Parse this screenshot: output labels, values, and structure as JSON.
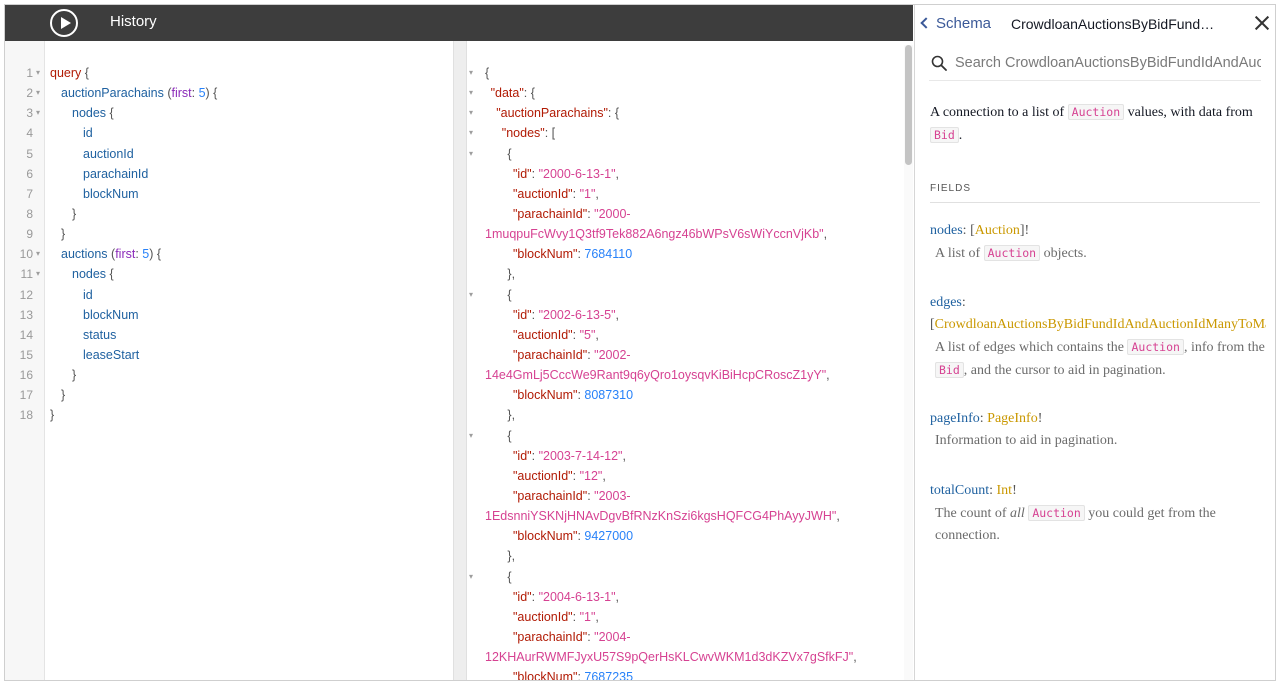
{
  "toolbar": {
    "history_label": "History"
  },
  "query": {
    "lines": [
      {
        "n": "1",
        "fold": true,
        "tokens": [
          {
            "t": "query",
            "c": "k-kw"
          },
          {
            "t": " {",
            "c": "k-punc"
          }
        ],
        "indent": 0
      },
      {
        "n": "2",
        "fold": true,
        "tokens": [
          {
            "t": "auctionParachains",
            "c": "k-def"
          },
          {
            "t": " (",
            "c": "k-punc"
          },
          {
            "t": "first",
            "c": "k-arg"
          },
          {
            "t": ": ",
            "c": "k-punc"
          },
          {
            "t": "5",
            "c": "k-num"
          },
          {
            "t": ") {",
            "c": "k-punc"
          }
        ],
        "indent": 1
      },
      {
        "n": "3",
        "fold": true,
        "tokens": [
          {
            "t": "nodes",
            "c": "k-def"
          },
          {
            "t": " {",
            "c": "k-punc"
          }
        ],
        "indent": 2
      },
      {
        "n": "4",
        "fold": false,
        "tokens": [
          {
            "t": "id",
            "c": "k-def"
          }
        ],
        "indent": 3
      },
      {
        "n": "5",
        "fold": false,
        "tokens": [
          {
            "t": "auctionId",
            "c": "k-def"
          }
        ],
        "indent": 3
      },
      {
        "n": "6",
        "fold": false,
        "tokens": [
          {
            "t": "parachainId",
            "c": "k-def"
          }
        ],
        "indent": 3
      },
      {
        "n": "7",
        "fold": false,
        "tokens": [
          {
            "t": "blockNum",
            "c": "k-def"
          }
        ],
        "indent": 3
      },
      {
        "n": "8",
        "fold": false,
        "tokens": [
          {
            "t": "}",
            "c": "k-punc"
          }
        ],
        "indent": 2
      },
      {
        "n": "9",
        "fold": false,
        "tokens": [
          {
            "t": "}",
            "c": "k-punc"
          }
        ],
        "indent": 1
      },
      {
        "n": "10",
        "fold": true,
        "tokens": [
          {
            "t": "auctions",
            "c": "k-def"
          },
          {
            "t": " (",
            "c": "k-punc"
          },
          {
            "t": "first",
            "c": "k-arg"
          },
          {
            "t": ": ",
            "c": "k-punc"
          },
          {
            "t": "5",
            "c": "k-num"
          },
          {
            "t": ") {",
            "c": "k-punc"
          }
        ],
        "indent": 1
      },
      {
        "n": "11",
        "fold": true,
        "tokens": [
          {
            "t": "nodes",
            "c": "k-def"
          },
          {
            "t": " {",
            "c": "k-punc"
          }
        ],
        "indent": 2
      },
      {
        "n": "12",
        "fold": false,
        "tokens": [
          {
            "t": "id",
            "c": "k-def"
          }
        ],
        "indent": 3
      },
      {
        "n": "13",
        "fold": false,
        "tokens": [
          {
            "t": "blockNum",
            "c": "k-def"
          }
        ],
        "indent": 3
      },
      {
        "n": "14",
        "fold": false,
        "tokens": [
          {
            "t": "status",
            "c": "k-def"
          }
        ],
        "indent": 3
      },
      {
        "n": "15",
        "fold": false,
        "tokens": [
          {
            "t": "leaseStart",
            "c": "k-def"
          }
        ],
        "indent": 3
      },
      {
        "n": "16",
        "fold": false,
        "tokens": [
          {
            "t": "}",
            "c": "k-punc"
          }
        ],
        "indent": 2
      },
      {
        "n": "17",
        "fold": false,
        "tokens": [
          {
            "t": "}",
            "c": "k-punc"
          }
        ],
        "indent": 1
      },
      {
        "n": "18",
        "fold": false,
        "tokens": [
          {
            "t": "}",
            "c": "k-punc"
          }
        ],
        "indent": 0
      }
    ]
  },
  "result": {
    "lines": [
      {
        "fold": true,
        "indent": 0,
        "tokens": [
          {
            "t": "{",
            "c": ""
          }
        ]
      },
      {
        "fold": true,
        "indent": 1,
        "tokens": [
          {
            "t": "\"data\"",
            "c": "r-key"
          },
          {
            "t": ": {",
            "c": ""
          }
        ]
      },
      {
        "fold": true,
        "indent": 2,
        "tokens": [
          {
            "t": "\"auctionParachains\"",
            "c": "r-key"
          },
          {
            "t": ": {",
            "c": ""
          }
        ]
      },
      {
        "fold": true,
        "indent": 3,
        "tokens": [
          {
            "t": "\"nodes\"",
            "c": "r-key"
          },
          {
            "t": ": [",
            "c": ""
          }
        ]
      },
      {
        "fold": true,
        "indent": 4,
        "tokens": [
          {
            "t": "{",
            "c": ""
          }
        ]
      },
      {
        "fold": false,
        "indent": 5,
        "tokens": [
          {
            "t": "\"id\"",
            "c": "r-key"
          },
          {
            "t": ": ",
            "c": ""
          },
          {
            "t": "\"2000-6-13-1\"",
            "c": "r-str"
          },
          {
            "t": ",",
            "c": ""
          }
        ]
      },
      {
        "fold": false,
        "indent": 5,
        "tokens": [
          {
            "t": "\"auctionId\"",
            "c": "r-key"
          },
          {
            "t": ": ",
            "c": ""
          },
          {
            "t": "\"1\"",
            "c": "r-str"
          },
          {
            "t": ",",
            "c": ""
          }
        ]
      },
      {
        "fold": false,
        "indent": 5,
        "tokens": [
          {
            "t": "\"parachainId\"",
            "c": "r-key"
          },
          {
            "t": ": ",
            "c": ""
          },
          {
            "t": "\"2000-",
            "c": "r-str"
          }
        ]
      },
      {
        "fold": false,
        "indent": 0,
        "tokens": [
          {
            "t": "1muqpuFcWvy1Q3tf9Tek882A6ngz46bWPsV6sWiYccnVjKb\"",
            "c": "r-str"
          },
          {
            "t": ",",
            "c": ""
          }
        ]
      },
      {
        "fold": false,
        "indent": 5,
        "tokens": [
          {
            "t": "\"blockNum\"",
            "c": "r-key"
          },
          {
            "t": ": ",
            "c": ""
          },
          {
            "t": "7684110",
            "c": "r-num"
          }
        ]
      },
      {
        "fold": false,
        "indent": 4,
        "tokens": [
          {
            "t": "},",
            "c": ""
          }
        ]
      },
      {
        "fold": true,
        "indent": 4,
        "tokens": [
          {
            "t": "{",
            "c": ""
          }
        ]
      },
      {
        "fold": false,
        "indent": 5,
        "tokens": [
          {
            "t": "\"id\"",
            "c": "r-key"
          },
          {
            "t": ": ",
            "c": ""
          },
          {
            "t": "\"2002-6-13-5\"",
            "c": "r-str"
          },
          {
            "t": ",",
            "c": ""
          }
        ]
      },
      {
        "fold": false,
        "indent": 5,
        "tokens": [
          {
            "t": "\"auctionId\"",
            "c": "r-key"
          },
          {
            "t": ": ",
            "c": ""
          },
          {
            "t": "\"5\"",
            "c": "r-str"
          },
          {
            "t": ",",
            "c": ""
          }
        ]
      },
      {
        "fold": false,
        "indent": 5,
        "tokens": [
          {
            "t": "\"parachainId\"",
            "c": "r-key"
          },
          {
            "t": ": ",
            "c": ""
          },
          {
            "t": "\"2002-",
            "c": "r-str"
          }
        ]
      },
      {
        "fold": false,
        "indent": 0,
        "tokens": [
          {
            "t": "14e4GmLj5CccWe9Rant9q6yQro1oysqvKiBiHcpCRoscZ1yY\"",
            "c": "r-str"
          },
          {
            "t": ",",
            "c": ""
          }
        ]
      },
      {
        "fold": false,
        "indent": 5,
        "tokens": [
          {
            "t": "\"blockNum\"",
            "c": "r-key"
          },
          {
            "t": ": ",
            "c": ""
          },
          {
            "t": "8087310",
            "c": "r-num"
          }
        ]
      },
      {
        "fold": false,
        "indent": 4,
        "tokens": [
          {
            "t": "},",
            "c": ""
          }
        ]
      },
      {
        "fold": true,
        "indent": 4,
        "tokens": [
          {
            "t": "{",
            "c": ""
          }
        ]
      },
      {
        "fold": false,
        "indent": 5,
        "tokens": [
          {
            "t": "\"id\"",
            "c": "r-key"
          },
          {
            "t": ": ",
            "c": ""
          },
          {
            "t": "\"2003-7-14-12\"",
            "c": "r-str"
          },
          {
            "t": ",",
            "c": ""
          }
        ]
      },
      {
        "fold": false,
        "indent": 5,
        "tokens": [
          {
            "t": "\"auctionId\"",
            "c": "r-key"
          },
          {
            "t": ": ",
            "c": ""
          },
          {
            "t": "\"12\"",
            "c": "r-str"
          },
          {
            "t": ",",
            "c": ""
          }
        ]
      },
      {
        "fold": false,
        "indent": 5,
        "tokens": [
          {
            "t": "\"parachainId\"",
            "c": "r-key"
          },
          {
            "t": ": ",
            "c": ""
          },
          {
            "t": "\"2003-",
            "c": "r-str"
          }
        ]
      },
      {
        "fold": false,
        "indent": 0,
        "tokens": [
          {
            "t": "1EdsnniYSKNjHNAvDgvBfRNzKnSzi6kgsHQFCG4PhAyyJWH\"",
            "c": "r-str"
          },
          {
            "t": ",",
            "c": ""
          }
        ]
      },
      {
        "fold": false,
        "indent": 5,
        "tokens": [
          {
            "t": "\"blockNum\"",
            "c": "r-key"
          },
          {
            "t": ": ",
            "c": ""
          },
          {
            "t": "9427000",
            "c": "r-num"
          }
        ]
      },
      {
        "fold": false,
        "indent": 4,
        "tokens": [
          {
            "t": "},",
            "c": ""
          }
        ]
      },
      {
        "fold": true,
        "indent": 4,
        "tokens": [
          {
            "t": "{",
            "c": ""
          }
        ]
      },
      {
        "fold": false,
        "indent": 5,
        "tokens": [
          {
            "t": "\"id\"",
            "c": "r-key"
          },
          {
            "t": ": ",
            "c": ""
          },
          {
            "t": "\"2004-6-13-1\"",
            "c": "r-str"
          },
          {
            "t": ",",
            "c": ""
          }
        ]
      },
      {
        "fold": false,
        "indent": 5,
        "tokens": [
          {
            "t": "\"auctionId\"",
            "c": "r-key"
          },
          {
            "t": ": ",
            "c": ""
          },
          {
            "t": "\"1\"",
            "c": "r-str"
          },
          {
            "t": ",",
            "c": ""
          }
        ]
      },
      {
        "fold": false,
        "indent": 5,
        "tokens": [
          {
            "t": "\"parachainId\"",
            "c": "r-key"
          },
          {
            "t": ": ",
            "c": ""
          },
          {
            "t": "\"2004-",
            "c": "r-str"
          }
        ]
      },
      {
        "fold": false,
        "indent": 0,
        "tokens": [
          {
            "t": "12KHAurRWMFJyxU57S9pQerHsKLCwvWKM1d3dKZVx7gSfkFJ\"",
            "c": "r-str"
          },
          {
            "t": ",",
            "c": ""
          }
        ]
      },
      {
        "fold": false,
        "indent": 5,
        "tokens": [
          {
            "t": "\"blockNum\"",
            "c": "r-key"
          },
          {
            "t": ": ",
            "c": ""
          },
          {
            "t": "7687235",
            "c": "r-num"
          }
        ]
      }
    ]
  },
  "docs": {
    "back_label": "Schema",
    "title": "CrowdloanAuctionsByBidFundIdAndAuctionIdManyToManyConnection",
    "search_placeholder": "Search CrowdloanAuctionsByBidFundIdAndAuctionIdManyToManyConnection...",
    "description": {
      "part1": "A connection to a list of ",
      "code1": "Auction",
      "part2": " values, with data from ",
      "code2": "Bid",
      "part3": "."
    },
    "fields_label": "FIELDS",
    "fields": {
      "nodes": {
        "name": "nodes",
        "type_open": "[",
        "type": "Auction",
        "type_close": "]!",
        "desc_a": "A list of ",
        "desc_code": "Auction",
        "desc_b": " objects."
      },
      "edges": {
        "name": "edges",
        "type_open": "[",
        "type": "CrowdloanAuctionsByBidFundIdAndAuctionIdManyToManyEdge",
        "type_close": "!]!",
        "desc_a": "A list of edges which contains the ",
        "desc_code1": "Auction",
        "desc_b": ", info from the ",
        "desc_code2": "Bid",
        "desc_c": ", and the cursor to aid in pagination."
      },
      "pageInfo": {
        "name": "pageInfo",
        "type": "PageInfo",
        "type_close": "!",
        "desc": "Information to aid in pagination."
      },
      "totalCount": {
        "name": "totalCount",
        "type": "Int",
        "type_close": "!",
        "desc_a": "The count of ",
        "desc_em": "all",
        "desc_code": "Auction",
        "desc_b": " you could get from the connection."
      }
    }
  }
}
